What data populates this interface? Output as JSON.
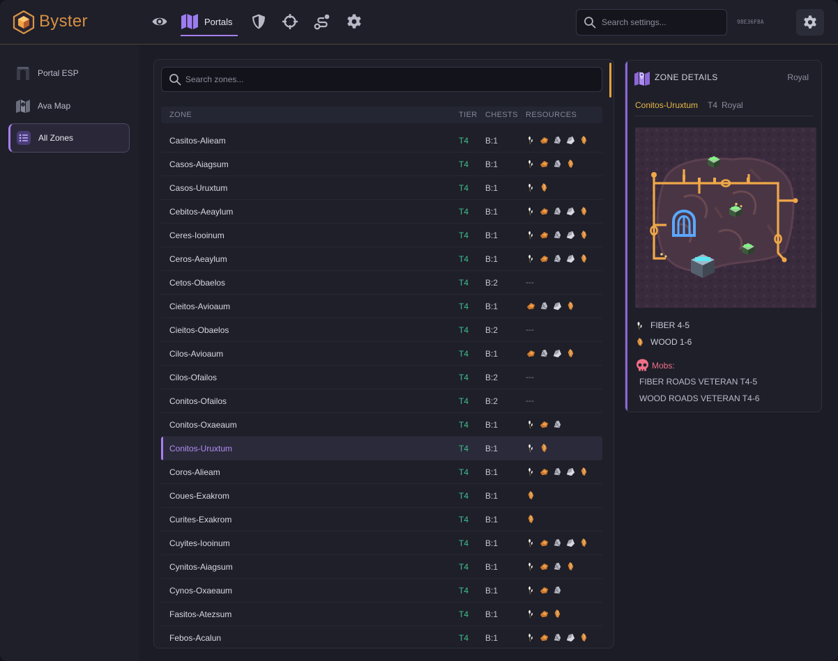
{
  "app": {
    "brand": "Byster",
    "session_id": "98E36F8A",
    "accent_color": "#a77ff0",
    "tier_color": "#3fbf8f",
    "highlight_color": "#e9b848"
  },
  "topnav": {
    "items": [
      {
        "icon": "eye-icon"
      },
      {
        "icon": "map-icon",
        "label": "Portals",
        "active": true
      },
      {
        "icon": "shield-icon"
      },
      {
        "icon": "crosshair-icon"
      },
      {
        "icon": "route-icon"
      },
      {
        "icon": "gear-icon"
      }
    ],
    "search_placeholder": "Search settings..."
  },
  "sidebar": {
    "items": [
      {
        "label": "Portal ESP",
        "icon": "portal-icon"
      },
      {
        "label": "Ava Map",
        "icon": "map-icon"
      },
      {
        "label": "All Zones",
        "icon": "list-icon",
        "active": true
      }
    ]
  },
  "zones": {
    "search_placeholder": "Search zones...",
    "columns": [
      "ZONE",
      "TIER",
      "CHESTS",
      "RESOURCES"
    ],
    "rows": [
      {
        "zone": "Casitos-Alieam",
        "tier": "T4",
        "chests": "B:1",
        "resources": [
          "fiber",
          "wood",
          "ore",
          "rock",
          "hide"
        ]
      },
      {
        "zone": "Casos-Aiagsum",
        "tier": "T4",
        "chests": "B:1",
        "resources": [
          "fiber",
          "wood",
          "ore",
          "hide"
        ]
      },
      {
        "zone": "Casos-Uruxtum",
        "tier": "T4",
        "chests": "B:1",
        "resources": [
          "fiber",
          "hide"
        ]
      },
      {
        "zone": "Cebitos-Aeaylum",
        "tier": "T4",
        "chests": "B:1",
        "resources": [
          "fiber",
          "wood",
          "ore",
          "rock",
          "hide"
        ]
      },
      {
        "zone": "Ceres-Iooinum",
        "tier": "T4",
        "chests": "B:1",
        "resources": [
          "fiber",
          "wood",
          "ore",
          "rock",
          "hide"
        ]
      },
      {
        "zone": "Ceros-Aeaylum",
        "tier": "T4",
        "chests": "B:1",
        "resources": [
          "fiber",
          "wood",
          "ore",
          "rock",
          "hide"
        ]
      },
      {
        "zone": "Cetos-Obaelos",
        "tier": "T4",
        "chests": "B:2",
        "resources": [],
        "empty": "---"
      },
      {
        "zone": "Cieitos-Avioaum",
        "tier": "T4",
        "chests": "B:1",
        "resources": [
          "wood",
          "ore",
          "rock",
          "hide"
        ]
      },
      {
        "zone": "Cieitos-Obaelos",
        "tier": "T4",
        "chests": "B:2",
        "resources": [],
        "empty": "---"
      },
      {
        "zone": "Cilos-Avioaum",
        "tier": "T4",
        "chests": "B:1",
        "resources": [
          "wood",
          "ore",
          "rock",
          "hide"
        ]
      },
      {
        "zone": "Cilos-Ofailos",
        "tier": "T4",
        "chests": "B:2",
        "resources": [],
        "empty": "---"
      },
      {
        "zone": "Conitos-Ofailos",
        "tier": "T4",
        "chests": "B:2",
        "resources": [],
        "empty": "---"
      },
      {
        "zone": "Conitos-Oxaeaum",
        "tier": "T4",
        "chests": "B:1",
        "resources": [
          "fiber",
          "wood",
          "ore"
        ]
      },
      {
        "zone": "Conitos-Uruxtum",
        "tier": "T4",
        "chests": "B:1",
        "resources": [
          "fiber",
          "hide"
        ],
        "selected": true
      },
      {
        "zone": "Coros-Alieam",
        "tier": "T4",
        "chests": "B:1",
        "resources": [
          "fiber",
          "wood",
          "ore",
          "rock",
          "hide"
        ]
      },
      {
        "zone": "Coues-Exakrom",
        "tier": "T4",
        "chests": "B:1",
        "resources": [
          "hide"
        ]
      },
      {
        "zone": "Curites-Exakrom",
        "tier": "T4",
        "chests": "B:1",
        "resources": [
          "hide"
        ]
      },
      {
        "zone": "Cuyites-Iooinum",
        "tier": "T4",
        "chests": "B:1",
        "resources": [
          "fiber",
          "wood",
          "ore",
          "rock",
          "hide"
        ]
      },
      {
        "zone": "Cynitos-Aiagsum",
        "tier": "T4",
        "chests": "B:1",
        "resources": [
          "fiber",
          "wood",
          "ore",
          "hide"
        ]
      },
      {
        "zone": "Cynos-Oxaeaum",
        "tier": "T4",
        "chests": "B:1",
        "resources": [
          "fiber",
          "wood",
          "ore"
        ]
      },
      {
        "zone": "Fasitos-Atezsum",
        "tier": "T4",
        "chests": "B:1",
        "resources": [
          "fiber",
          "wood",
          "hide"
        ]
      },
      {
        "zone": "Febos-Acalun",
        "tier": "T4",
        "chests": "B:1",
        "resources": [
          "fiber",
          "wood",
          "ore",
          "rock",
          "hide"
        ]
      }
    ]
  },
  "details": {
    "title": "ZONE DETAILS",
    "type": "Royal",
    "zone": "Conitos-Uruxtum",
    "tier": "T4",
    "category": "Royal",
    "resources": [
      {
        "icon": "fiber",
        "text": "FIBER 4-5"
      },
      {
        "icon": "hide",
        "text": "WOOD 1-6"
      }
    ],
    "mobs_label": "Mobs:",
    "mobs": [
      "FIBER ROADS VETERAN  T4-5",
      "WOOD ROADS VETERAN  T4-6"
    ]
  }
}
